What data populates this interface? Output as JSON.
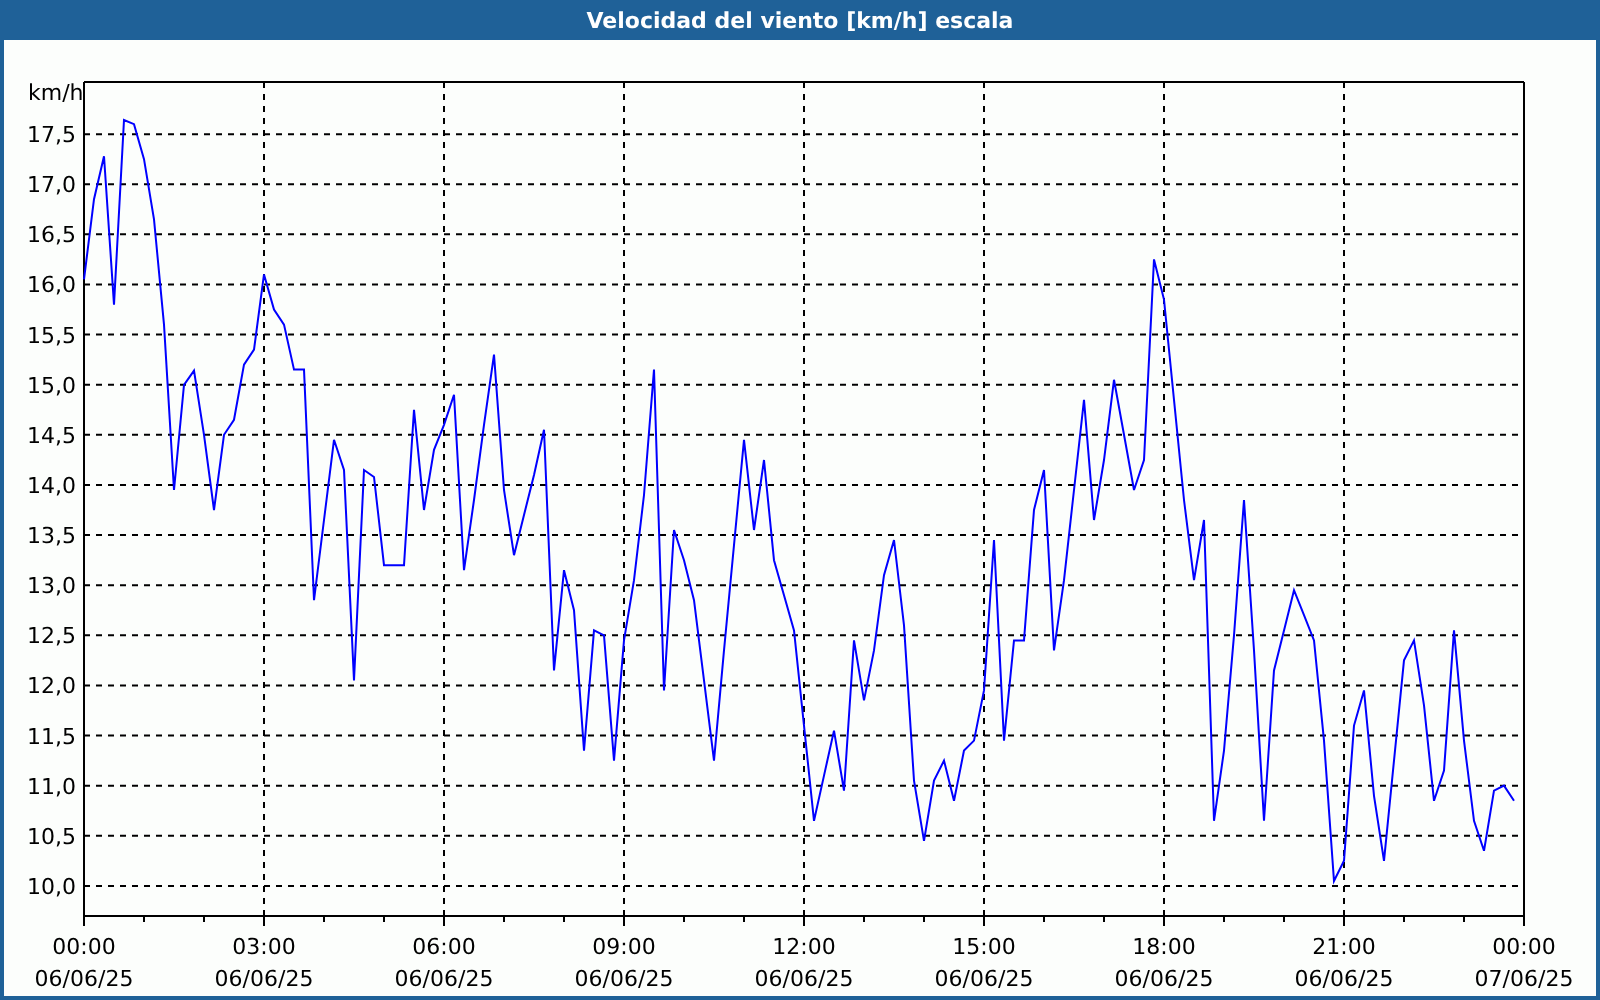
{
  "chart_data": {
    "type": "line",
    "title": "Velocidad del viento [km/h] escala",
    "ylabel": "km/h",
    "categories": [
      "00:00\n06/06/25",
      null,
      null,
      null,
      null,
      null,
      null,
      null,
      null,
      null,
      null,
      null,
      null,
      null,
      null,
      null,
      null,
      null,
      "03:00\n06/06/25",
      null,
      null,
      null,
      null,
      null,
      null,
      null,
      null,
      null,
      null,
      null,
      null,
      null,
      null,
      null,
      null,
      null,
      "06:00\n06/06/25",
      null,
      null,
      null,
      null,
      null,
      null,
      null,
      null,
      null,
      null,
      null,
      null,
      null,
      null,
      null,
      null,
      null,
      "09:00\n06/06/25",
      null,
      null,
      null,
      null,
      null,
      null,
      null,
      null,
      null,
      null,
      null,
      null,
      null,
      null,
      null,
      null,
      null,
      "12:00\n06/06/25",
      null,
      null,
      null,
      null,
      null,
      null,
      null,
      null,
      null,
      null,
      null,
      null,
      null,
      null,
      null,
      null,
      null,
      "15:00\n06/06/25",
      null,
      null,
      null,
      null,
      null,
      null,
      null,
      null,
      null,
      null,
      null,
      null,
      null,
      null,
      null,
      null,
      null,
      "18:00\n06/06/25",
      null,
      null,
      null,
      null,
      null,
      null,
      null,
      null,
      null,
      null,
      null,
      null,
      null,
      null,
      null,
      null,
      null,
      "21:00\n06/06/25",
      null,
      null,
      null,
      null,
      null,
      null,
      null,
      null,
      null,
      null,
      null,
      null,
      null,
      null,
      null,
      null,
      null,
      "00:00\n07/06/25"
    ],
    "series": [
      {
        "color": "#0000ff",
        "values": [
          16.05,
          16.85,
          17.28,
          15.8,
          17.64,
          17.6,
          17.25,
          16.65,
          15.6,
          13.95,
          15.0,
          15.14,
          14.5,
          13.75,
          14.5,
          14.65,
          15.2,
          15.35,
          16.1,
          15.75,
          15.6,
          15.15,
          15.15,
          12.85,
          13.65,
          14.45,
          14.15,
          12.05,
          14.15,
          14.08,
          13.2,
          13.2,
          13.2,
          14.75,
          13.75,
          14.35,
          14.6,
          14.9,
          13.15,
          13.85,
          14.6,
          15.3,
          13.95,
          13.3,
          13.7,
          14.1,
          14.55,
          12.15,
          13.15,
          12.75,
          11.35,
          12.55,
          12.5,
          11.25,
          12.45,
          13.05,
          13.9,
          15.15,
          11.95,
          13.55,
          13.25,
          12.85,
          12.05,
          11.25,
          12.35,
          13.4,
          14.45,
          13.55,
          14.25,
          13.25,
          12.9,
          12.55,
          11.6,
          10.65,
          11.1,
          11.55,
          10.95,
          12.45,
          11.85,
          12.35,
          13.1,
          13.45,
          12.6,
          11.05,
          10.45,
          11.05,
          11.25,
          10.85,
          11.35,
          11.45,
          11.95,
          13.45,
          11.45,
          12.45,
          12.45,
          13.75,
          14.15,
          12.35,
          13.05,
          13.95,
          14.85,
          13.65,
          14.25,
          15.05,
          14.5,
          13.95,
          14.25,
          16.25,
          15.85,
          14.85,
          13.85,
          13.05,
          13.65,
          10.65,
          11.35,
          12.5,
          13.85,
          12.35,
          10.65,
          12.15,
          12.55,
          12.95,
          12.7,
          12.45,
          11.45,
          10.05,
          10.25,
          11.6,
          11.95,
          10.9,
          10.25,
          11.25,
          12.25,
          12.45,
          11.8,
          10.85,
          11.15,
          12.55,
          11.45,
          10.65,
          10.35,
          10.95,
          11.0,
          10.85,
          null
        ]
      }
    ],
    "grid": true,
    "ylim": [
      9.7,
      18.02
    ],
    "yticks": [
      {
        "value": 10,
        "label": "10,0"
      },
      {
        "value": 10.5,
        "label": "10,5"
      },
      {
        "value": 11,
        "label": "11,0"
      },
      {
        "value": 11.5,
        "label": "11,5"
      },
      {
        "value": 12,
        "label": "12,0"
      },
      {
        "value": 12.5,
        "label": "12,5"
      },
      {
        "value": 13,
        "label": "13,0"
      },
      {
        "value": 13.5,
        "label": "13,5"
      },
      {
        "value": 14,
        "label": "14,0"
      },
      {
        "value": 14.5,
        "label": "14,5"
      },
      {
        "value": 15,
        "label": "15,0"
      },
      {
        "value": 15.5,
        "label": "15,5"
      },
      {
        "value": 16,
        "label": "16,0"
      },
      {
        "value": 16.5,
        "label": "16,5"
      },
      {
        "value": 17,
        "label": "17,0"
      },
      {
        "value": 17.5,
        "label": "17,5"
      }
    ]
  }
}
